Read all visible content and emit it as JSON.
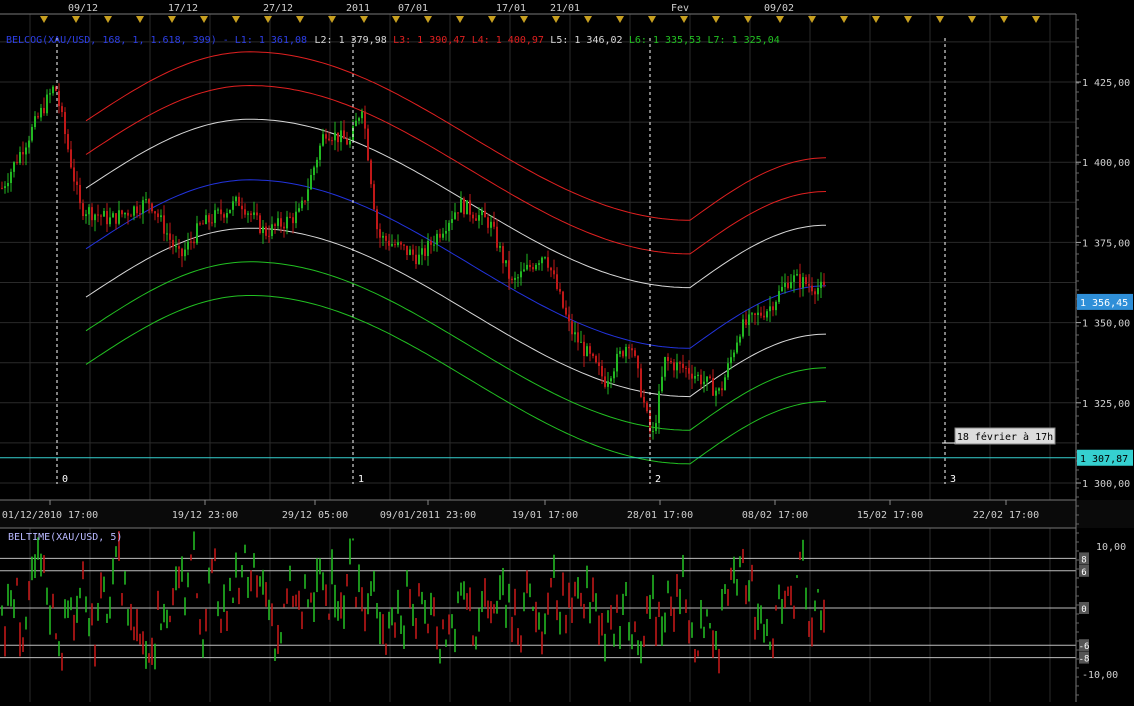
{
  "top_axis": {
    "labels": [
      "09/12",
      "17/12",
      "27/12",
      "2011",
      "07/01",
      "17/01",
      "21/01",
      "Fev",
      "09/02"
    ]
  },
  "legend": [
    {
      "text": "BELCOG(XAU/USD, 168, 1, 1.618, 399) - L1: 1 361,08",
      "color": "#2d3fe8"
    },
    {
      "text": "L2: 1 379,98",
      "color": "#d8d8d8"
    },
    {
      "text": "L3: 1 390,47",
      "color": "#e02020"
    },
    {
      "text": "L4: 1 400,97",
      "color": "#e02020"
    },
    {
      "text": "L5: 1 346,02",
      "color": "#d8d8d8"
    },
    {
      "text": "L6: 1 335,53",
      "color": "#22c022"
    },
    {
      "text": "L7: 1 325,04",
      "color": "#22c022"
    }
  ],
  "main_price_axis": {
    "ticks": [
      "1 425,00",
      "1 400,00",
      "1 375,00",
      "1 350,00",
      "1 325,00",
      "1 300,00"
    ],
    "last_price": "1 356,45",
    "hline_price": "1 307,87"
  },
  "time_axis": {
    "labels": [
      "01/12/2010 17:00",
      "19/12 23:00",
      "29/12 05:00",
      "09/01/2011 23:00",
      "19/01 17:00",
      "28/01 17:00",
      "08/02 17:00",
      "15/02 17:00",
      "22/02 17:00"
    ]
  },
  "cycles": {
    "labels": [
      "0",
      "1",
      "2",
      "3"
    ]
  },
  "annotation": {
    "text": "18 février à 17h"
  },
  "oscillator": {
    "title": "BELTIME(XAU/USD, 5)",
    "axis_labels": [
      "10,00",
      "-10,00"
    ],
    "level_labels": [
      "8",
      "6",
      "0",
      "-6",
      "-8"
    ]
  },
  "colors": {
    "background": "#000000",
    "grid": "#2a2a2a",
    "candle_up": "#22b822",
    "candle_down": "#c01818",
    "median": "#2233dd",
    "inner_band": "#d8d8d8",
    "upper_band": "#e02020",
    "lower_band": "#22c022",
    "hline": "#35d0d0",
    "last_price_badge": "#2f8fd8"
  },
  "chart_data": [
    {
      "type": "line",
      "title": "",
      "xlabel": "",
      "ylabel": "",
      "ylim": [
        1296,
        1440
      ],
      "x_ticks": [
        "01/12/2010 17:00",
        "19/12 23:00",
        "29/12 05:00",
        "09/01/2011 23:00",
        "19/01 17:00",
        "28/01 17:00",
        "08/02 17:00",
        "15/02 17:00",
        "22/02 17:00"
      ],
      "y_ticks": [
        1300,
        1325,
        1350,
        1375,
        1400,
        1425
      ],
      "series": [
        {
          "name": "L1",
          "last": 1361.08
        },
        {
          "name": "L2",
          "last": 1379.98
        },
        {
          "name": "L3",
          "last": 1390.47
        },
        {
          "name": "L4",
          "last": 1400.97
        },
        {
          "name": "L5",
          "last": 1346.02
        },
        {
          "name": "L6",
          "last": 1335.53
        },
        {
          "name": "L7",
          "last": 1325.04
        }
      ],
      "price_path": [
        {
          "x": "01/12/2010 17:00",
          "y": 1392
        },
        {
          "x": "09/12",
          "y": 1424
        },
        {
          "x": "17/12",
          "y": 1376
        },
        {
          "x": "27/12",
          "y": 1385
        },
        {
          "x": "2011",
          "y": 1418
        },
        {
          "x": "07/01",
          "y": 1375
        },
        {
          "x": "17/01",
          "y": 1385
        },
        {
          "x": "21/01",
          "y": 1368
        },
        {
          "x": "28/01 17:00",
          "y": 1312
        },
        {
          "x": "Fev",
          "y": 1338
        },
        {
          "x": "08/02 17:00",
          "y": 1350
        },
        {
          "x": "09/02",
          "y": 1360
        }
      ],
      "current_price": 1356.45,
      "horizontal_line": 1307.87,
      "cycle_markers": [
        "0",
        "1",
        "2",
        "3"
      ],
      "grid": true
    },
    {
      "type": "bar",
      "title": "BELTIME(XAU/USD, 5)",
      "ylim": [
        -13,
        12
      ],
      "y_ticks": [
        10,
        -10
      ],
      "reference_levels": [
        8,
        6,
        0,
        -6,
        -8
      ],
      "grid": true
    }
  ]
}
